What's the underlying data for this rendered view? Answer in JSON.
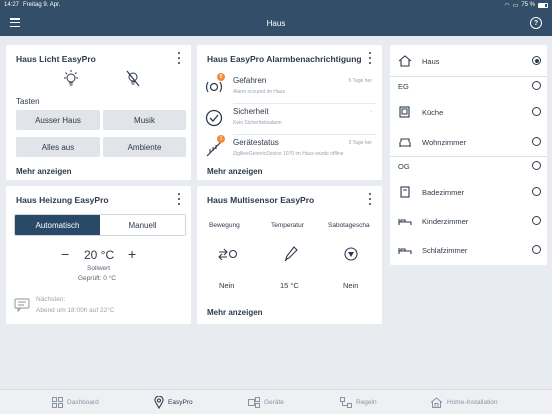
{
  "status": {
    "time": "14:27",
    "date": "Freitag 9. Apr.",
    "battery": "75 %"
  },
  "nav": {
    "title": "Haus"
  },
  "licht": {
    "title": "Haus Licht EasyPro",
    "tasten_label": "Tasten",
    "buttons": [
      "Ausser Haus",
      "Musik",
      "Alles aus",
      "Ambiente"
    ],
    "more": "Mehr anzeigen"
  },
  "alarm": {
    "title": "Haus EasyPro Alarmbenachrichtigung",
    "items": [
      {
        "title": "Gefahren",
        "subtitle": "Alarm occured im Haus",
        "date": "5  Tage her",
        "badge": "8"
      },
      {
        "title": "Sicherheit",
        "subtitle": "Kein Sicherheitsalarm",
        "date": "-",
        "badge": ""
      },
      {
        "title": "Gerätestatus",
        "subtitle": "ZigBeeGenericDevice 1070 im Haus wurde offline",
        "date": "3  Tage her",
        "badge": "1"
      }
    ],
    "more": "Mehr anzeigen"
  },
  "heizung": {
    "title": "Haus Heizung EasyPro",
    "mode_auto": "Automatisch",
    "mode_manual": "Manuell",
    "minus": "−",
    "temp": "20 °C",
    "plus": "+",
    "sollwert": "Sollwert",
    "gemessen": "Geprüft:  0 °C",
    "next_label": "Nächsten:",
    "next_value": "Abend um 18:00h auf 22°C"
  },
  "multisensor": {
    "title": "Haus Multisensor EasyPro",
    "cols": [
      {
        "label": "Bewegung",
        "value": "Nein"
      },
      {
        "label": "Temperatur",
        "value": "15 °C"
      },
      {
        "label": "Sabotagescha",
        "value": "Nein"
      }
    ],
    "more": "Mehr anzeigen"
  },
  "rooms": {
    "haus": "Haus",
    "eg": "EG",
    "kueche": "Küche",
    "wohnzimmer": "Wohnzimmer",
    "og": "OG",
    "badezimmer": "Badezimmer",
    "kinderzimmer": "Kinderzimmer",
    "schlafzimmer": "Schlafzimmer"
  },
  "tabs": [
    "Dashboard",
    "EasyPro",
    "Geräte",
    "Regeln",
    "Home-Installation"
  ],
  "colors": {
    "primary": "#334e68",
    "accent_button": "#294968",
    "badge": "#f08a3c",
    "background": "#e8ebef"
  }
}
